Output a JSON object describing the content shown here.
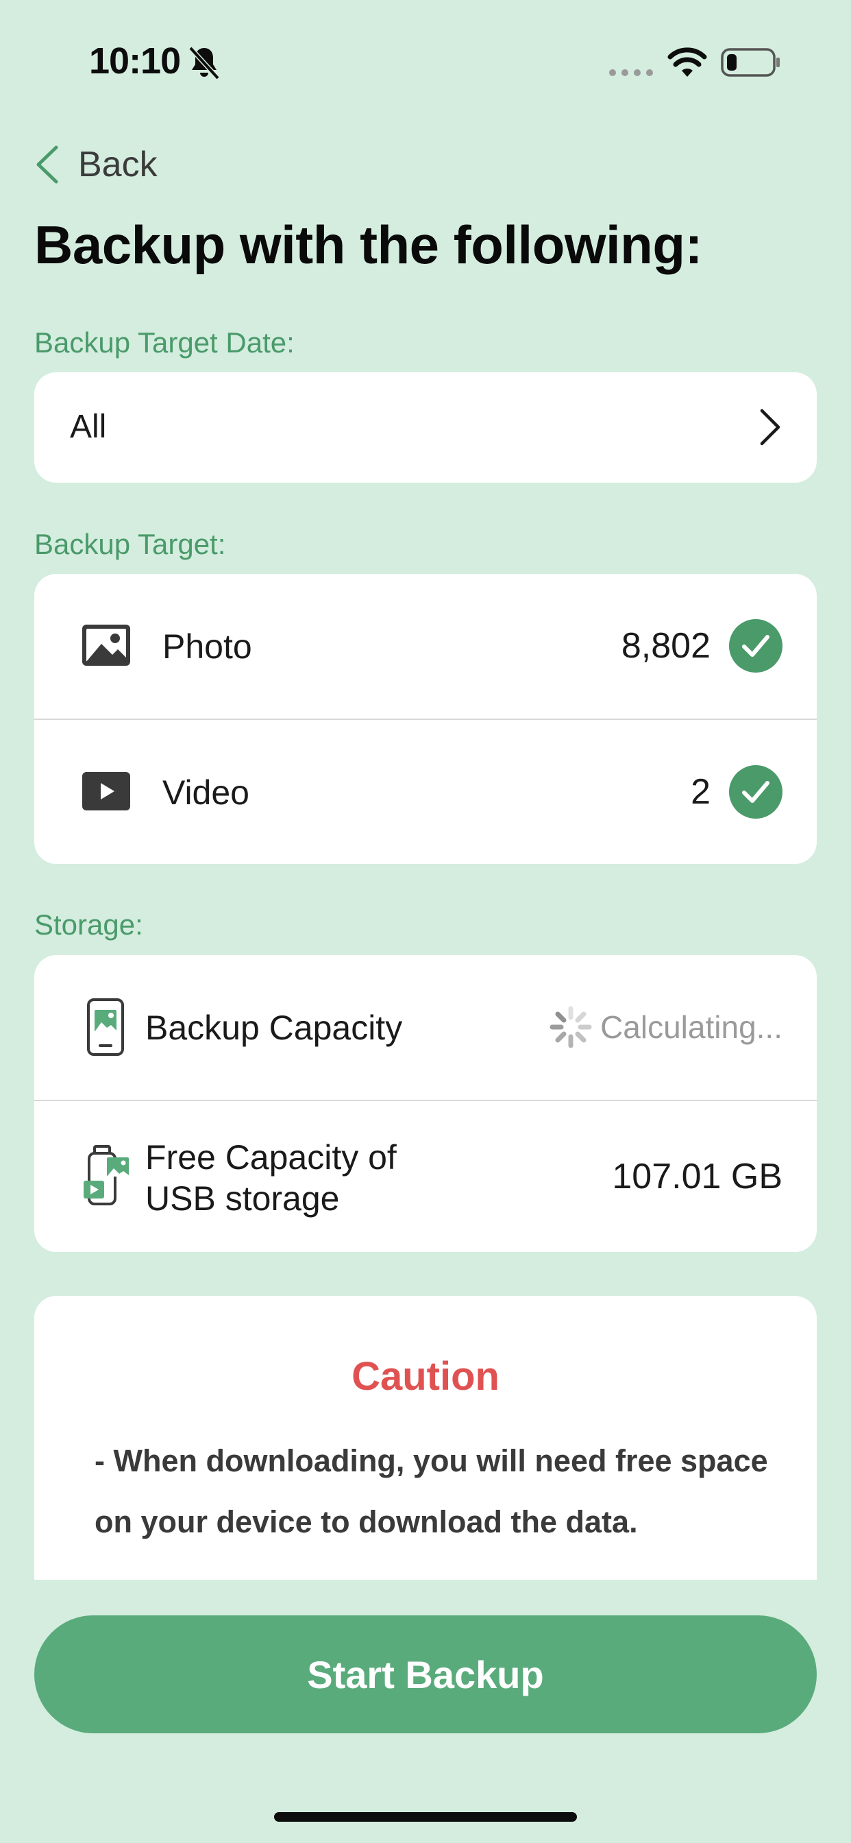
{
  "status_bar": {
    "time": "10:10"
  },
  "header": {
    "back_label": "Back",
    "title": "Backup with the following:"
  },
  "target_date": {
    "label": "Backup Target Date:",
    "value": "All"
  },
  "backup_target": {
    "label": "Backup Target:",
    "items": [
      {
        "label": "Photo",
        "count": "8,802",
        "icon": "photo-icon",
        "checked": true
      },
      {
        "label": "Video",
        "count": "2",
        "icon": "video-icon",
        "checked": true
      }
    ]
  },
  "storage": {
    "label": "Storage:",
    "backup_capacity": {
      "label": "Backup Capacity",
      "value": "Calculating..."
    },
    "free_capacity": {
      "label_line1": "Free Capacity of",
      "label_line2": "USB storage",
      "value": "107.01 GB"
    }
  },
  "caution": {
    "title": "Caution",
    "text": "- When downloading, you will need free space on your device to download the data."
  },
  "start_button_label": "Start Backup",
  "colors": {
    "background": "#d4eddf",
    "accent": "#5aab7c",
    "check": "#4a9a6a",
    "caution": "#e05252"
  }
}
